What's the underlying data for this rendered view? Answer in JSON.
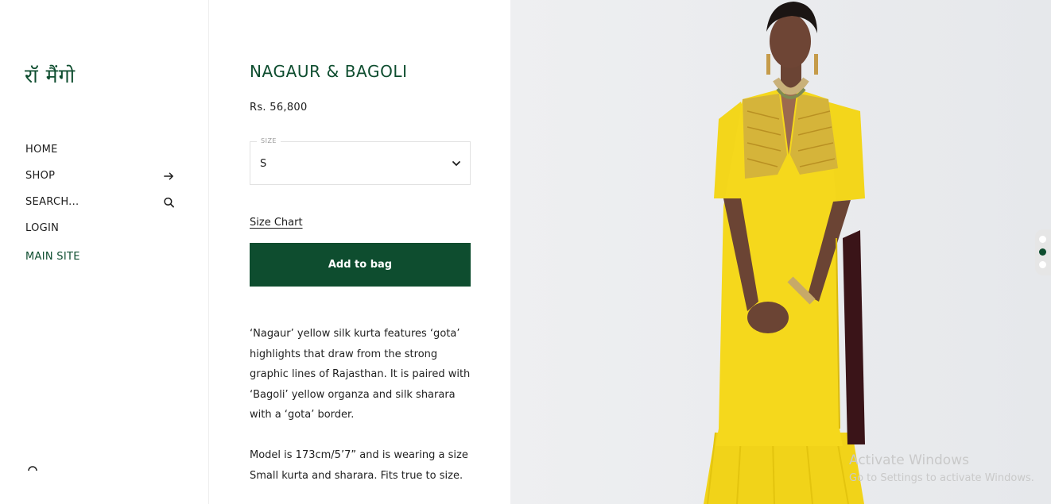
{
  "sidebar": {
    "logo": "रॉ मैंगो",
    "nav": [
      {
        "label": "HOME"
      },
      {
        "label": "SHOP",
        "icon": "arrow-right-icon"
      },
      {
        "label": "SEARCH...",
        "icon": "search-icon"
      },
      {
        "label": "LOGIN"
      },
      {
        "label": "MAIN SITE"
      }
    ]
  },
  "product": {
    "title": "NAGAUR & BAGOLI",
    "price": "Rs. 56,800",
    "size_label": "SIZE",
    "size_value": "S",
    "size_chart": "Size Chart",
    "add_to_bag": "Add to bag",
    "description": "‘Nagaur’ yellow silk kurta features ‘gota’ highlights that draw from the strong graphic lines of Rajasthan. It is paired with ‘Bagoli’ yellow organza and silk sharara with a ‘gota’ border.",
    "model_info": "Model is 173cm/5’7” and is wearing a size Small kurta and sharara. Fits true to size."
  },
  "gallery": {
    "dots": 3,
    "active_dot": 2
  },
  "watermark": {
    "line1": "Activate Windows",
    "line2": "Go to Settings to activate Windows."
  },
  "colors": {
    "brand_green": "#0e4d2f",
    "dress_yellow": "#f2d21a",
    "photo_bg": "#edeef0"
  }
}
